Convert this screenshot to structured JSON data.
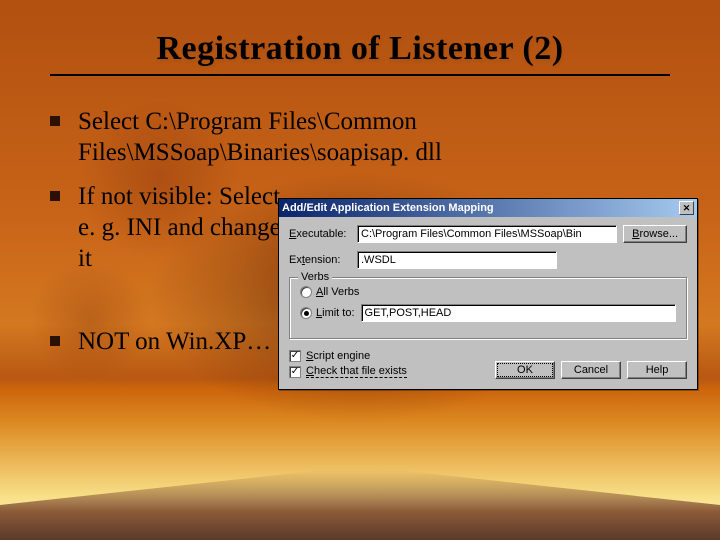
{
  "slide": {
    "title": "Registration of Listener (2)",
    "bullets": [
      "Select C:\\Program Files\\Common Files\\MSSoap\\Binaries\\soapisap. dll",
      "If not visible: Select e. g. INI and change it",
      "NOT on Win.XP…"
    ]
  },
  "dialog": {
    "title": "Add/Edit Application Extension Mapping",
    "close": "✕",
    "labels": {
      "executable_pre": "E",
      "executable_post": "xecutable:",
      "extension_pre": "Ex",
      "extension_u": "t",
      "extension_post": "ension:",
      "verbs": "Verbs",
      "all_pre": "",
      "all_u": "A",
      "all_post": "ll Verbs",
      "limit_pre": "",
      "limit_u": "L",
      "limit_post": "imit to:",
      "script_pre": "",
      "script_u": "S",
      "script_post": "cript engine",
      "check_pre": "",
      "check_u": "C",
      "check_post": "heck that file exists",
      "browse_pre": "",
      "browse_u": "B",
      "browse_post": "rowse..."
    },
    "values": {
      "executable": "C:\\Program Files\\Common Files\\MSSoap\\Bin",
      "extension": ".WSDL",
      "limit": "GET,POST,HEAD"
    },
    "buttons": {
      "ok": "OK",
      "cancel": "Cancel",
      "help": "Help"
    },
    "radio_selected": "limit",
    "checks": {
      "script": true,
      "file": true
    }
  }
}
